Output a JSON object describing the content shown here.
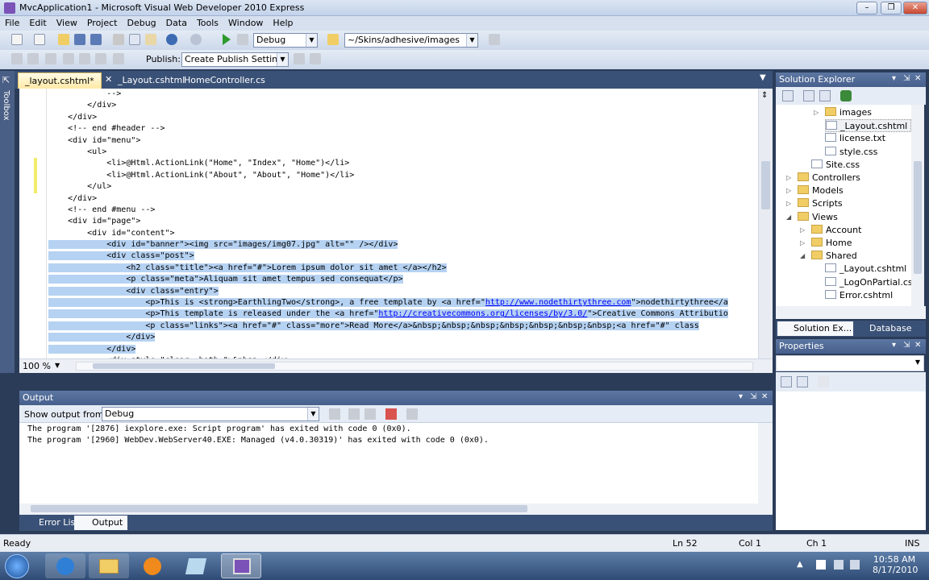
{
  "window": {
    "title": "MvcApplication1 - Microsoft Visual Web Developer 2010 Express"
  },
  "menu": [
    "File",
    "Edit",
    "View",
    "Project",
    "Debug",
    "Data",
    "Tools",
    "Window",
    "Help"
  ],
  "toolbar": {
    "config": "Debug",
    "path": "~/Skins/adhesive/images",
    "publish_label": "Publish:",
    "publish_value": "Create Publish Settings"
  },
  "toolbox_label": "Toolbox",
  "doc_tabs": [
    {
      "label": "_layout.cshtml*",
      "active": true
    },
    {
      "label": "_Layout.cshtml",
      "active": false
    },
    {
      "label": "HomeController.cs",
      "active": false
    }
  ],
  "code_lines": [
    {
      "text": "            -->",
      "selected": false,
      "changed": false
    },
    {
      "text": "        </div>",
      "selected": false,
      "changed": false
    },
    {
      "text": "    </div>",
      "selected": false,
      "changed": false
    },
    {
      "text": "    <!-- end #header -->",
      "selected": false,
      "changed": false
    },
    {
      "text": "    <div id=\"menu\">",
      "selected": false,
      "changed": false
    },
    {
      "text": "        <ul>",
      "selected": false,
      "changed": false
    },
    {
      "text": "            <li>@Html.ActionLink(\"Home\", \"Index\", \"Home\")</li>",
      "selected": false,
      "changed": true
    },
    {
      "text": "            <li>@Html.ActionLink(\"About\", \"About\", \"Home\")</li>",
      "selected": false,
      "changed": true
    },
    {
      "text": "        </ul>",
      "selected": false,
      "changed": true
    },
    {
      "text": "    </div>",
      "selected": false,
      "changed": false
    },
    {
      "text": "    <!-- end #menu -->",
      "selected": false,
      "changed": false
    },
    {
      "text": "    <div id=\"page\">",
      "selected": false,
      "changed": false
    },
    {
      "text": "        <div id=\"content\">",
      "selected": false,
      "changed": false
    },
    {
      "text": "            <div id=\"banner\"><img src=\"images/img07.jpg\" alt=\"\" /></div>",
      "selected": true,
      "changed": false
    },
    {
      "text": "            <div class=\"post\">",
      "selected": true,
      "changed": false
    },
    {
      "text": "                <h2 class=\"title\"><a href=\"#\">Lorem ipsum dolor sit amet </a></h2>",
      "selected": true,
      "changed": false
    },
    {
      "text": "                <p class=\"meta\">Aliquam sit amet tempus sed consequat</p>",
      "selected": true,
      "changed": false
    },
    {
      "text": "                <div class=\"entry\">",
      "selected": true,
      "changed": false
    },
    {
      "text": "                    <p>This is <strong>EarthlingTwo</strong>, a free template by <a href=\"",
      "link": "http://www.nodethirtythree.com",
      "after": "\">nodethirtythree</a",
      "selected": true,
      "changed": false
    },
    {
      "text": "                    <p>This template is released under the <a href=\"",
      "link": "http://creativecommons.org/licenses/by/3.0/",
      "after": "\">Creative Commons Attributio",
      "selected": true,
      "changed": false
    },
    {
      "text": "                    <p class=\"links\"><a href=\"#\" class=\"more\">Read More</a>&nbsp;&nbsp;&nbsp;&nbsp;&nbsp;&nbsp;&nbsp;<a href=\"#\" class",
      "selected": true,
      "changed": false
    },
    {
      "text": "                </div>",
      "selected": true,
      "changed": false
    },
    {
      "text": "            </div>",
      "selected": true,
      "changed": false
    },
    {
      "text": "            <div style=\"clear: both;\">&nbsp;</div>",
      "selected": false,
      "changed": false
    }
  ],
  "editor_zoom": "100 %",
  "output": {
    "title": "Output",
    "show_from_label": "Show output from:",
    "show_from_value": "Debug",
    "lines": [
      "The program '[2876] iexplore.exe: Script program' has exited with code 0 (0x0).",
      "The program '[2960] WebDev.WebServer40.EXE: Managed (v4.0.30319)' has exited with code 0 (0x0)."
    ]
  },
  "bottom_tabs": [
    {
      "label": "Error List",
      "active": false
    },
    {
      "label": "Output",
      "active": true
    }
  ],
  "solution_explorer": {
    "title": "Solution Explorer",
    "items": [
      {
        "label": "images",
        "type": "folder",
        "depth": 3,
        "expander": "▷"
      },
      {
        "label": "_Layout.cshtml",
        "type": "file",
        "depth": 3,
        "expander": "",
        "selected": true
      },
      {
        "label": "license.txt",
        "type": "file",
        "depth": 3,
        "expander": ""
      },
      {
        "label": "style.css",
        "type": "file",
        "depth": 3,
        "expander": ""
      },
      {
        "label": "Site.css",
        "type": "file",
        "depth": 2,
        "expander": ""
      },
      {
        "label": "Controllers",
        "type": "folder",
        "depth": 1,
        "expander": "▷"
      },
      {
        "label": "Models",
        "type": "folder",
        "depth": 1,
        "expander": "▷"
      },
      {
        "label": "Scripts",
        "type": "folder",
        "depth": 1,
        "expander": "▷"
      },
      {
        "label": "Views",
        "type": "folder",
        "depth": 1,
        "expander": "◢"
      },
      {
        "label": "Account",
        "type": "folder",
        "depth": 2,
        "expander": "▷"
      },
      {
        "label": "Home",
        "type": "folder",
        "depth": 2,
        "expander": "▷"
      },
      {
        "label": "Shared",
        "type": "folder",
        "depth": 2,
        "expander": "◢"
      },
      {
        "label": "_Layout.cshtml",
        "type": "file",
        "depth": 3,
        "expander": ""
      },
      {
        "label": "_LogOnPartial.csht",
        "type": "file",
        "depth": 3,
        "expander": ""
      },
      {
        "label": "Error.cshtml",
        "type": "file",
        "depth": 3,
        "expander": ""
      }
    ],
    "tabs": [
      "Solution Ex...",
      "Database Ex..."
    ]
  },
  "properties": {
    "title": "Properties"
  },
  "statusbar": {
    "state": "Ready",
    "ln": "Ln 52",
    "col": "Col 1",
    "ch": "Ch 1",
    "ins": "INS"
  },
  "taskbar": {
    "time": "10:58 AM",
    "date": "8/17/2010"
  }
}
